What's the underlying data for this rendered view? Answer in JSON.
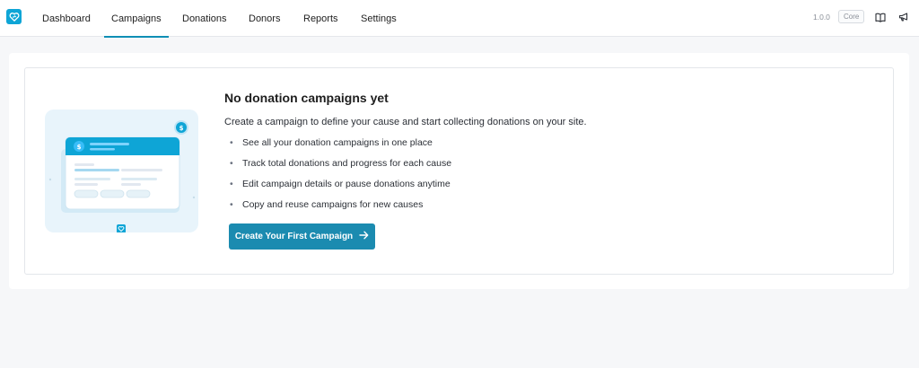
{
  "nav": {
    "items": [
      {
        "label": "Dashboard",
        "active": false
      },
      {
        "label": "Campaigns",
        "active": true
      },
      {
        "label": "Donations",
        "active": false
      },
      {
        "label": "Donors",
        "active": false
      },
      {
        "label": "Reports",
        "active": false
      },
      {
        "label": "Settings",
        "active": false
      }
    ],
    "version": "1.0.0",
    "edition_badge": "Core",
    "icons": [
      "book-icon",
      "megaphone-icon"
    ]
  },
  "empty_state": {
    "title": "No donation campaigns yet",
    "description": "Create a campaign to define your cause and start collecting donations on your site.",
    "bullets": [
      "See all your donation campaigns in one place",
      "Track total donations and progress for each cause",
      "Edit campaign details or pause donations anytime",
      "Copy and reuse campaigns for new causes"
    ],
    "cta_label": "Create Your First Campaign",
    "illustration_coin_symbol": "$"
  },
  "colors": {
    "accent": "#1b8bb0",
    "brand": "#0ea5d6",
    "illustration_bg": "#e8f4fb"
  }
}
